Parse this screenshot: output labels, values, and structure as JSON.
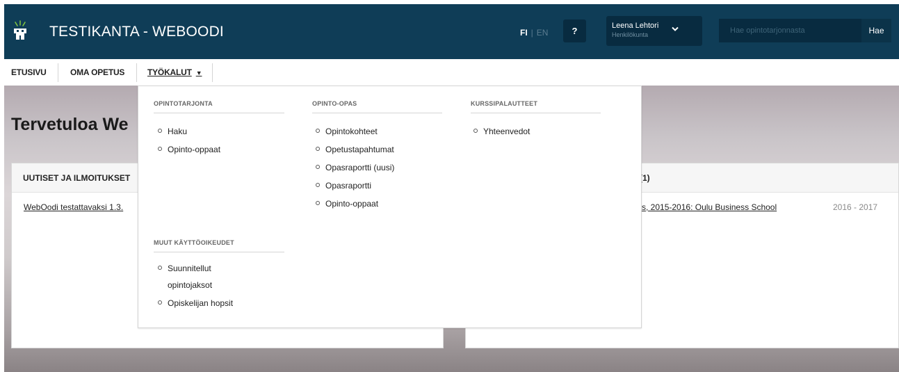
{
  "header": {
    "title": "TESTIKANTA - WEBOODI",
    "lang_fi": "FI",
    "lang_sep": "|",
    "lang_en": "EN",
    "help_label": "?",
    "user_name": "Leena Lehtori",
    "user_role": "Henkilökunta",
    "search_placeholder": "Hae opintotarjonnasta",
    "search_button": "Hae",
    "colors": {
      "header_bg": "#0f3d57",
      "control_bg": "#082b40"
    }
  },
  "nav": {
    "items": [
      {
        "label": "ETUSIVU"
      },
      {
        "label": "OMA OPETUS"
      },
      {
        "label": "TYÖKALUT"
      }
    ]
  },
  "main": {
    "welcome": "Tervetuloa We",
    "news_panel": {
      "title": "UUTISET JA ILMOITUKSET",
      "link": "WebOodi testattavaksi 1.3."
    },
    "right_panel": {
      "title": "(1)",
      "link": "nts, 2015-2016: Oulu Business School",
      "year": "2016 - 2017"
    }
  },
  "dropdown": {
    "col1": {
      "title": "OPINTOTARJONTA",
      "items": [
        "Haku",
        "Opinto-oppaat"
      ]
    },
    "col1b": {
      "title": "MUUT KÄYTTÖOIKEUDET",
      "items": [
        "Suunnitellut opintojaksot",
        "Opiskelijan hopsit"
      ]
    },
    "col2": {
      "title": "OPINTO-OPAS",
      "items": [
        "Opintokohteet",
        "Opetustapahtumat",
        "Opasraportti (uusi)",
        "Opasraportti",
        "Opinto-oppaat"
      ]
    },
    "col3": {
      "title": "KURSSIPALAUTTEET",
      "items": [
        "Yhteenvedot"
      ]
    }
  }
}
